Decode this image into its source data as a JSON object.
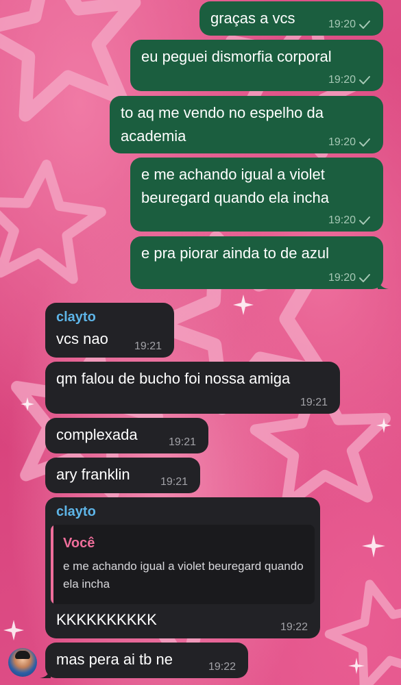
{
  "messages": [
    {
      "direction": "out",
      "text": "graças a vcs",
      "time": "19:20"
    },
    {
      "direction": "out",
      "text": "eu peguei dismorfia corporal",
      "time": "19:20"
    },
    {
      "direction": "out",
      "text": "to aq me vendo no espelho da academia",
      "time": "19:20"
    },
    {
      "direction": "out",
      "text": "e me achando igual a violet beuregard quando ela incha",
      "time": "19:20"
    },
    {
      "direction": "out",
      "text": "e pra piorar ainda to de azul",
      "time": "19:20"
    },
    {
      "direction": "in",
      "sender": "clayto",
      "text": "vcs nao",
      "time": "19:21"
    },
    {
      "direction": "in",
      "text": "qm falou de bucho foi nossa amiga",
      "time": "19:21"
    },
    {
      "direction": "in",
      "text": "complexada",
      "time": "19:21"
    },
    {
      "direction": "in",
      "text": "ary franklin",
      "time": "19:21"
    },
    {
      "direction": "in",
      "sender": "clayto",
      "reply_to": {
        "name": "Você",
        "text": "e me achando igual a violet beuregard quando ela incha"
      },
      "text": "KKKKKKKKKK",
      "time": "19:22"
    },
    {
      "direction": "in",
      "text": "mas pera ai tb ne",
      "time": "19:22"
    }
  ],
  "colors": {
    "outgoing_bubble": "#1b5e3f",
    "incoming_bubble": "#222226",
    "sender_name": "#5eb5e8",
    "reply_accent": "#ef6e9b",
    "wallpaper": "#d9487f"
  },
  "icons": {
    "read_status": "single-check-icon",
    "sender_avatar": "avatar"
  }
}
